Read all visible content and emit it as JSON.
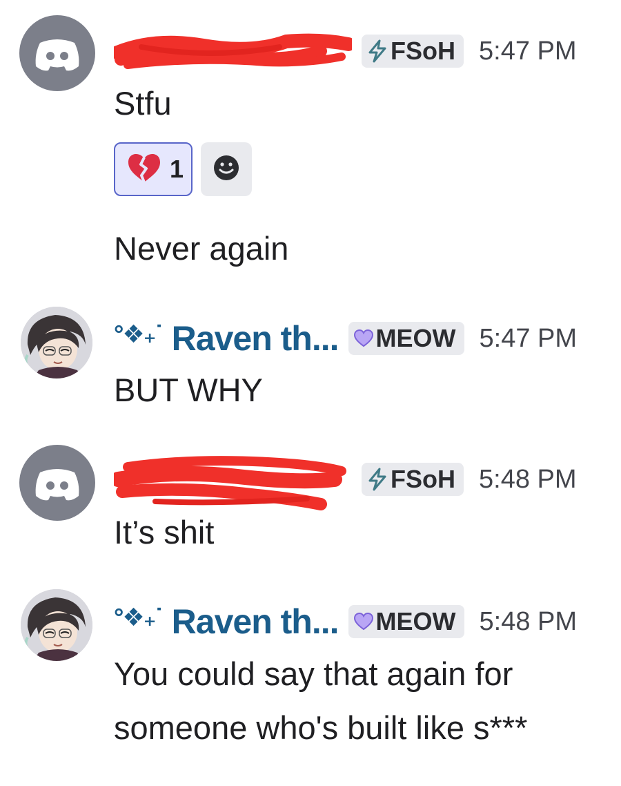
{
  "messages": [
    {
      "avatar": "discord-default-avatar",
      "username_redacted": true,
      "tag": {
        "icon": "lightning-icon",
        "label": "FSoH"
      },
      "time": "5:47 PM",
      "lines": [
        "Stfu"
      ],
      "reactions": [
        {
          "emoji": "broken-heart-icon",
          "count": "1"
        }
      ],
      "followup": "Never again"
    },
    {
      "avatar": "raven-avatar",
      "username_prefix": "°❖₊˙",
      "username": "Raven th...",
      "tag": {
        "icon": "purple-heart-icon",
        "label": "MEOW"
      },
      "time": "5:47 PM",
      "lines": [
        "BUT WHY"
      ]
    },
    {
      "avatar": "discord-default-avatar",
      "username_redacted": true,
      "tag": {
        "icon": "lightning-icon",
        "label": "FSoH"
      },
      "time": "5:48 PM",
      "lines": [
        "It’s shit"
      ]
    },
    {
      "avatar": "raven-avatar",
      "username_prefix": "°❖₊˙",
      "username": "Raven th...",
      "tag": {
        "icon": "purple-heart-icon",
        "label": "MEOW"
      },
      "time": "5:48 PM",
      "lines": [
        "You could say that again for",
        "someone who's built like s***"
      ]
    }
  ],
  "colors": {
    "username": "#1b5d8b",
    "tag_bg": "#e9eaee",
    "reaction_active_bg": "#e6e7fd",
    "reaction_active_border": "#5865c9",
    "redaction": "#f0302a",
    "discord_avatar": "#7c7f8a"
  }
}
